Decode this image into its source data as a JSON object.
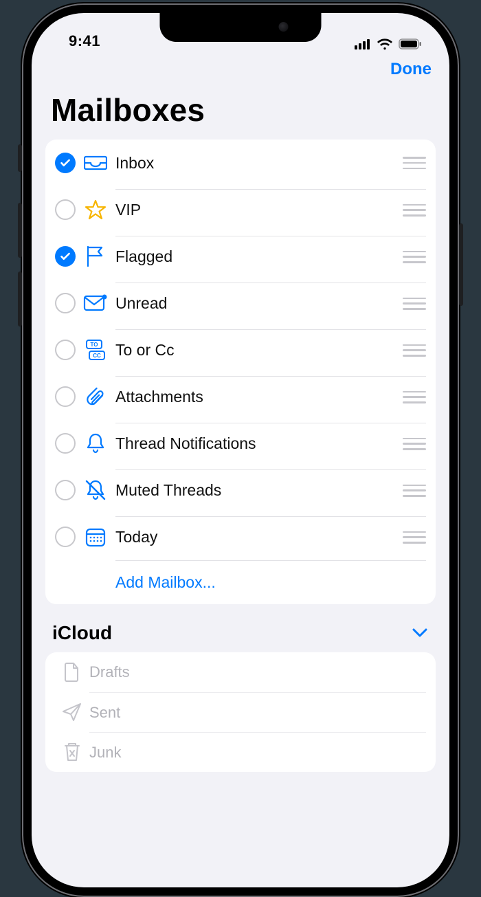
{
  "status": {
    "time": "9:41"
  },
  "nav": {
    "done_label": "Done"
  },
  "title": "Mailboxes",
  "smart_mailboxes": [
    {
      "label": "Inbox",
      "icon": "tray-icon",
      "checked": true
    },
    {
      "label": "VIP",
      "icon": "star-icon",
      "checked": false
    },
    {
      "label": "Flagged",
      "icon": "flag-icon",
      "checked": true
    },
    {
      "label": "Unread",
      "icon": "mail-unread-icon",
      "checked": false
    },
    {
      "label": "To or Cc",
      "icon": "to-cc-icon",
      "checked": false
    },
    {
      "label": "Attachments",
      "icon": "paperclip-icon",
      "checked": false
    },
    {
      "label": "Thread Notifications",
      "icon": "bell-icon",
      "checked": false
    },
    {
      "label": "Muted Threads",
      "icon": "bell-slash-icon",
      "checked": false
    },
    {
      "label": "Today",
      "icon": "calendar-icon",
      "checked": false
    }
  ],
  "add_mailbox_label": "Add Mailbox...",
  "account_section": {
    "title": "iCloud",
    "items": [
      {
        "label": "Drafts",
        "icon": "doc-icon"
      },
      {
        "label": "Sent",
        "icon": "paperplane-icon"
      },
      {
        "label": "Junk",
        "icon": "trash-x-icon"
      }
    ]
  },
  "colors": {
    "accent": "#007aff",
    "star": "#f7b500"
  }
}
